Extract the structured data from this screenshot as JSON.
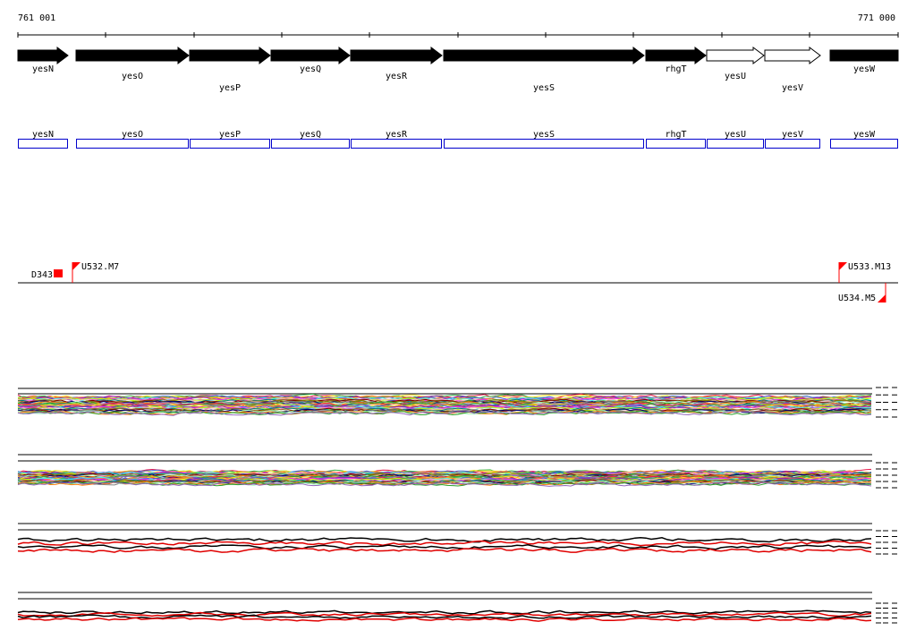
{
  "coordinates": {
    "start": "761 001",
    "end": "771 000"
  },
  "genes": [
    {
      "name": "yesN",
      "filled": true
    },
    {
      "name": "yesO",
      "filled": true
    },
    {
      "name": "yesP",
      "filled": true
    },
    {
      "name": "yesQ",
      "filled": true
    },
    {
      "name": "yesR",
      "filled": true
    },
    {
      "name": "yesS",
      "filled": true
    },
    {
      "name": "rhgT",
      "filled": true
    },
    {
      "name": "yesU",
      "filled": false
    },
    {
      "name": "yesV",
      "filled": false
    },
    {
      "name": "yesW",
      "filled": true
    }
  ],
  "markers": [
    {
      "name": "D343"
    },
    {
      "name": "U532.M7"
    },
    {
      "name": "U533.M13"
    },
    {
      "name": "U534.M5"
    }
  ],
  "colors": {
    "gene_fill": "#000000",
    "gene_box": "#0000cc",
    "marker": "#ff0000",
    "profile_primary": "#000000",
    "profile_secondary": "#e00000",
    "profile_palette": [
      "#e6194b",
      "#3cb44b",
      "#ffe119",
      "#4363d8",
      "#f58231",
      "#911eb4",
      "#46f0f0",
      "#f032e6",
      "#bcf60c",
      "#fabebe",
      "#008080",
      "#9a6324",
      "#800000",
      "#808000",
      "#000075",
      "#808080",
      "#aaffc3",
      "#ff7f0e",
      "#2ca02c",
      "#9467bd"
    ]
  }
}
